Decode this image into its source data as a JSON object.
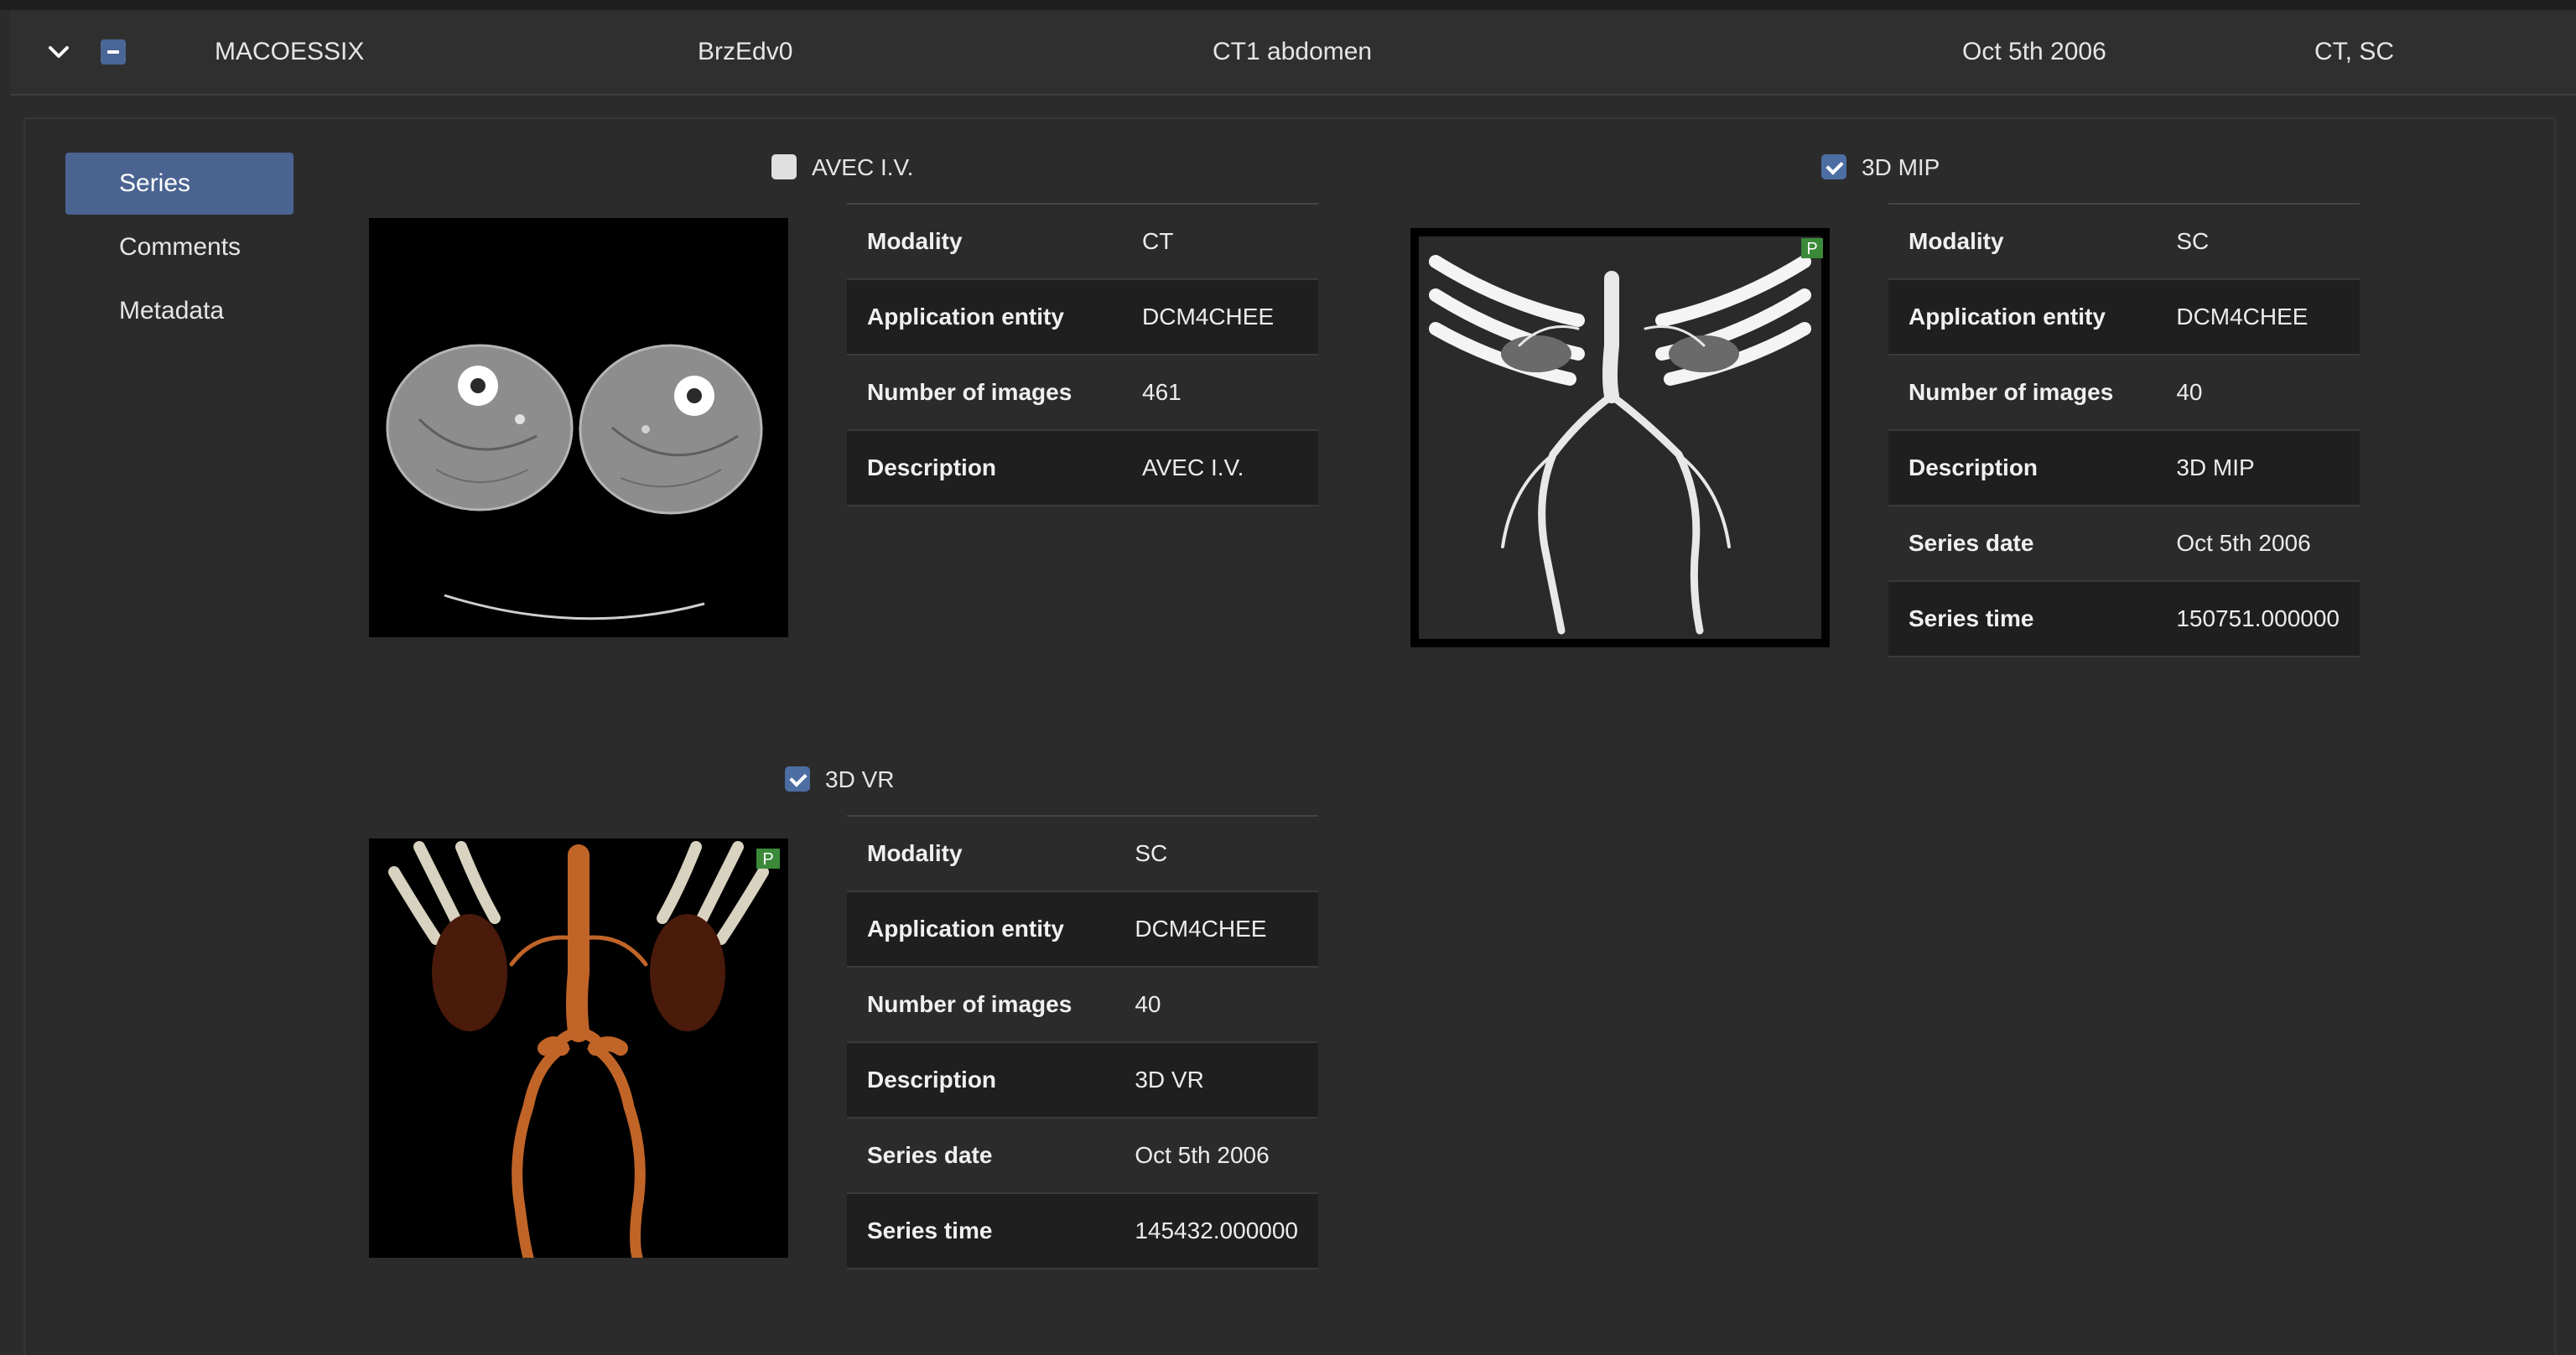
{
  "study": {
    "patient_name": "MACOESSIX",
    "patient_id": "BrzEdv0",
    "description": "CT1 abdomen",
    "date": "Oct 5th 2006",
    "modalities": "CT, SC"
  },
  "nav": {
    "items": [
      {
        "label": "Series",
        "active": true
      },
      {
        "label": "Comments",
        "active": false
      },
      {
        "label": "Metadata",
        "active": false
      }
    ]
  },
  "series": [
    {
      "title": "AVEC I.V.",
      "checked": false,
      "thumbnail": "axial-ct-legs",
      "rows": [
        {
          "key": "Modality",
          "value": "CT"
        },
        {
          "key": "Application entity",
          "value": "DCM4CHEE"
        },
        {
          "key": "Number of images",
          "value": "461"
        },
        {
          "key": "Description",
          "value": "AVEC I.V."
        }
      ]
    },
    {
      "title": "3D MIP",
      "checked": true,
      "thumbnail": "mip-angiography",
      "rows": [
        {
          "key": "Modality",
          "value": "SC"
        },
        {
          "key": "Application entity",
          "value": "DCM4CHEE"
        },
        {
          "key": "Number of images",
          "value": "40"
        },
        {
          "key": "Description",
          "value": "3D MIP"
        },
        {
          "key": "Series date",
          "value": "Oct 5th 2006"
        },
        {
          "key": "Series time",
          "value": "150751.000000"
        }
      ]
    },
    {
      "title": "3D VR",
      "checked": true,
      "thumbnail": "volume-render-aorta",
      "rows": [
        {
          "key": "Modality",
          "value": "SC"
        },
        {
          "key": "Application entity",
          "value": "DCM4CHEE"
        },
        {
          "key": "Number of images",
          "value": "40"
        },
        {
          "key": "Description",
          "value": "3D VR"
        },
        {
          "key": "Series date",
          "value": "Oct 5th 2006"
        },
        {
          "key": "Series time",
          "value": "145432.000000"
        }
      ]
    }
  ],
  "colors": {
    "accent": "#4a6391",
    "checkbox_on": "#4d6ea3",
    "background": "#2b2b2b",
    "row_alt": "#1f1f1f"
  }
}
